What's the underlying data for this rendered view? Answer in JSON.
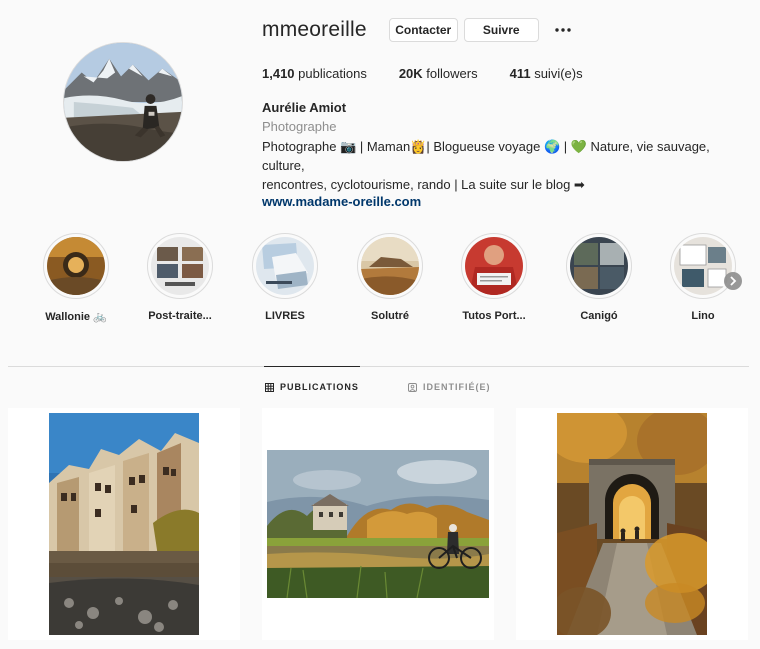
{
  "profile": {
    "username": "mmeoreille",
    "contact_label": "Contacter",
    "follow_label": "Suivre",
    "more_icon": "more-horizontal-icon",
    "stats": {
      "posts_count": "1,410",
      "posts_label": " publications",
      "followers_count": "20K",
      "followers_label": " followers",
      "following_count": "411",
      "following_label": " suivi(e)s"
    },
    "full_name": "Aurélie Amiot",
    "category": "Photographe",
    "bio_line1": "Photographe 📷 | Maman👸| Blogueuse voyage 🌍 | 💚 Nature, vie sauvage, culture,",
    "bio_line2": "rencontres, cyclotourisme, rando | La suite sur le blog ➡",
    "website": "www.madame-oreille.com"
  },
  "highlights": [
    {
      "label": "Wallonie 🚲"
    },
    {
      "label": "Post-traite..."
    },
    {
      "label": "LIVRES"
    },
    {
      "label": "Solutré"
    },
    {
      "label": "Tutos Port..."
    },
    {
      "label": "Canigó"
    },
    {
      "label": "Lino"
    }
  ],
  "tabs": [
    {
      "label": "PUBLICATIONS",
      "icon": "grid-icon",
      "active": true
    },
    {
      "label": "IDENTIFIÉ(E)",
      "icon": "tagged-icon",
      "active": false
    }
  ],
  "posts_visible": 3
}
